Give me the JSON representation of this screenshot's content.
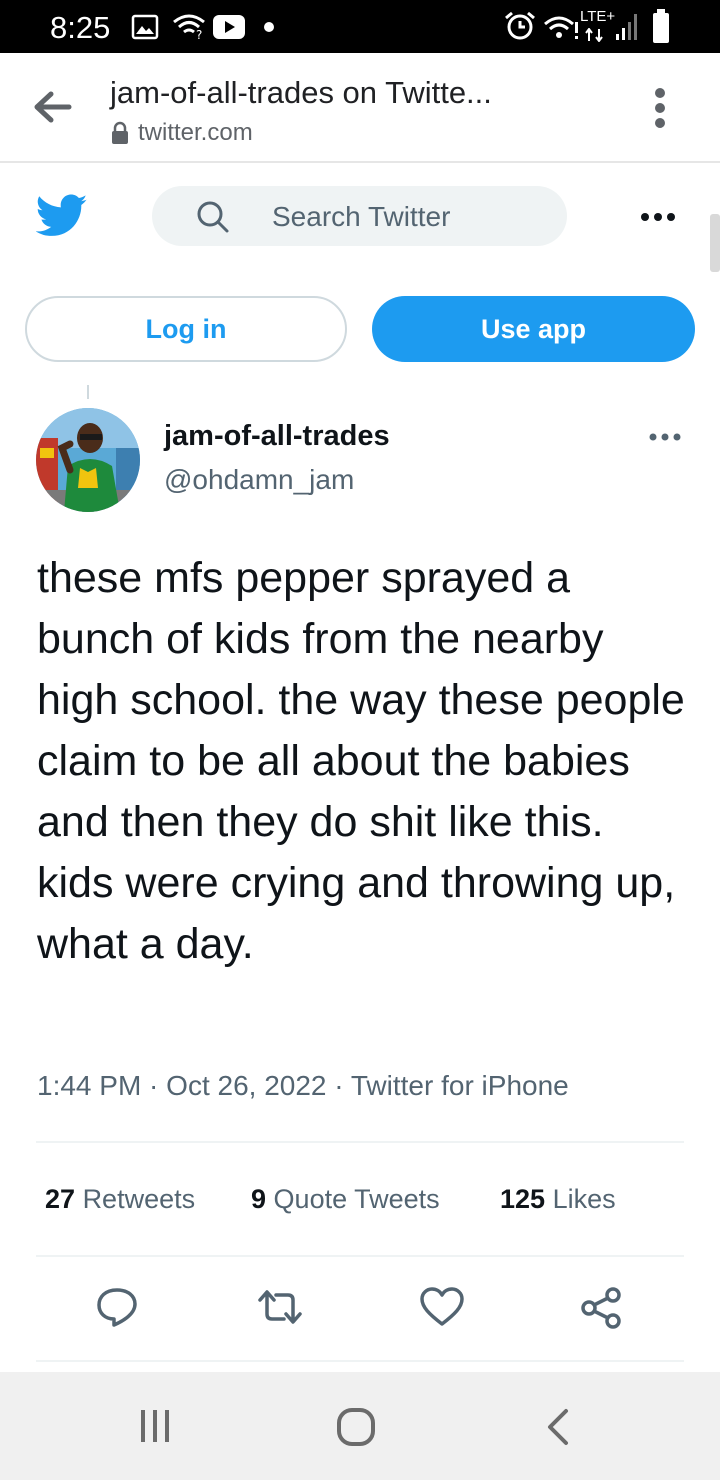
{
  "status_bar": {
    "time": "8:25",
    "network_label": "LTE+",
    "icons": [
      "gallery-icon",
      "wifi-icon",
      "youtube-icon",
      "dot-icon",
      "alarm-icon",
      "wifi-calling-icon",
      "signal-icon",
      "battery-icon"
    ]
  },
  "browser": {
    "page_title": "jam-of-all-trades on Twitte...",
    "url": "twitter.com",
    "icons": [
      "back-arrow-icon",
      "lock-icon",
      "kebab-menu-icon"
    ]
  },
  "twitter_header": {
    "search_placeholder": "Search Twitter",
    "login_label": "Log in",
    "use_app_label": "Use app",
    "brand_color": "#1d9bf0"
  },
  "tweet": {
    "display_name": "jam-of-all-trades",
    "handle": "@ohdamn_jam",
    "text": "these mfs pepper sprayed a bunch of kids from the nearby high school. the way these people claim to be all about the babies and then they do shit like this. kids were crying and throwing up, what a day.",
    "timestamp": "1:44 PM · Oct 26, 2022 · Twitter for iPhone",
    "stats": {
      "retweets_count": "27",
      "retweets_label": "Retweets",
      "quotes_count": "9",
      "quotes_label": "Quote Tweets",
      "likes_count": "125",
      "likes_label": "Likes"
    },
    "actions": [
      "reply-icon",
      "retweet-icon",
      "like-icon",
      "share-icon"
    ]
  },
  "nav_bar": {
    "buttons": [
      "recents-icon",
      "home-icon",
      "back-icon"
    ]
  }
}
